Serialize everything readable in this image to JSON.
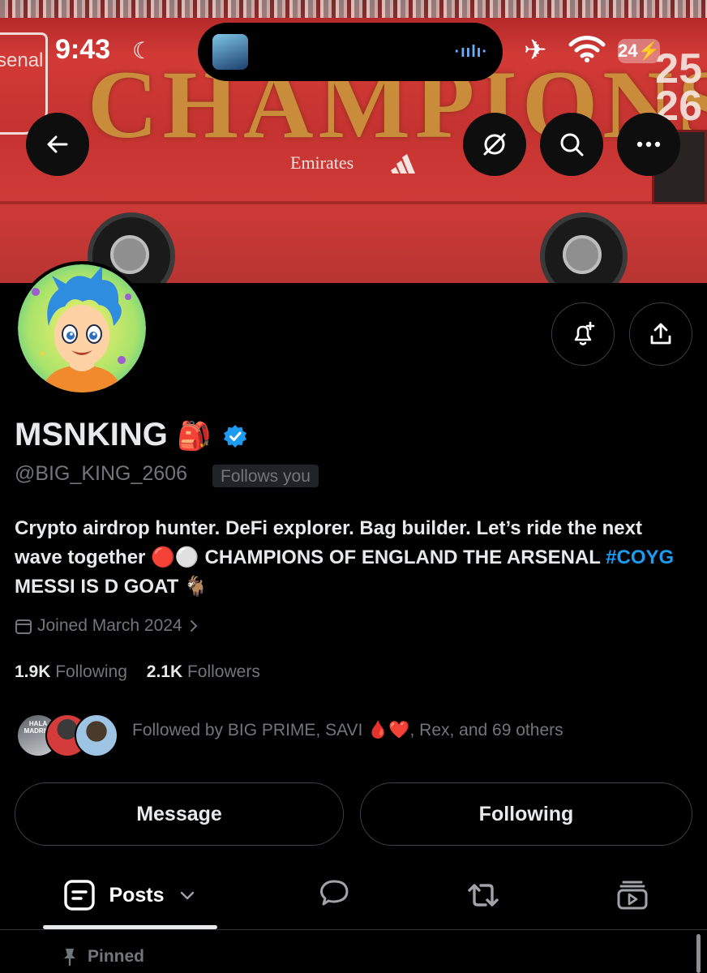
{
  "status_bar": {
    "time": "9:43",
    "battery": "24"
  },
  "banner": {
    "headline": "CHAMPIONS",
    "years": [
      "25",
      "26"
    ],
    "sponsor": "Emirates",
    "crest_text": "senal"
  },
  "profile": {
    "display_name": "MSNKING",
    "name_emoji": "🎒",
    "handle": "@BIG_KING_2606",
    "follows_you_label": "Follows you",
    "bio_part1": "Crypto airdrop hunter. DeFi explorer. Bag builder. Let’s ride the next wave together 🔴⚪ CHAMPIONS OF ENGLAND THE ARSENAL ",
    "bio_hashtag": "#COYG",
    "bio_part2": " MESSI IS D GOAT 🐐",
    "joined": "Joined March 2024",
    "following_count": "1.9K",
    "following_label": "Following",
    "followers_count": "2.1K",
    "followers_label": "Followers",
    "followed_by": "Followed by BIG PRIME, SAVI 🩸❤️, Rex, and 69 others",
    "follower_avatar_text": "HALA MADRID!"
  },
  "actions": {
    "message_label": "Message",
    "following_label": "Following"
  },
  "tabs": {
    "posts_label": "Posts"
  },
  "pinned_label": "Pinned",
  "colors": {
    "background": "#000000",
    "text_primary": "#e7e9ea",
    "text_secondary": "#71767b",
    "accent": "#1d9bf0",
    "verified": "#1d9bf0"
  }
}
